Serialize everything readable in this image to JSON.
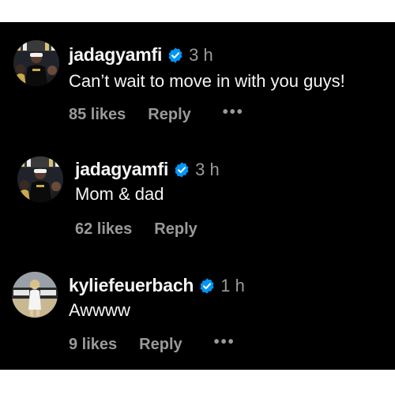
{
  "colors": {
    "background": "#000000",
    "primary_text": "#f5f5f5",
    "secondary_text": "#9a9a9a",
    "verified_badge": "#0095f6"
  },
  "comments": [
    {
      "username": "jadagyamfi",
      "verified": true,
      "verified_icon": "verified-badge-icon",
      "time": "3 h",
      "text": "Can’t wait to move in with you guys!",
      "likes": "85 likes",
      "reply": "Reply",
      "more": "•••"
    },
    {
      "username": "jadagyamfi",
      "verified": true,
      "verified_icon": "verified-badge-icon",
      "time": "3 h",
      "text": "Mom & dad",
      "likes": "62 likes",
      "reply": "Reply",
      "more": ""
    },
    {
      "username": "kyliefeuerbach",
      "verified": true,
      "verified_icon": "verified-badge-icon",
      "time": "1 h",
      "text": "Awwww",
      "likes": "9 likes",
      "reply": "Reply",
      "more": "•••"
    }
  ]
}
